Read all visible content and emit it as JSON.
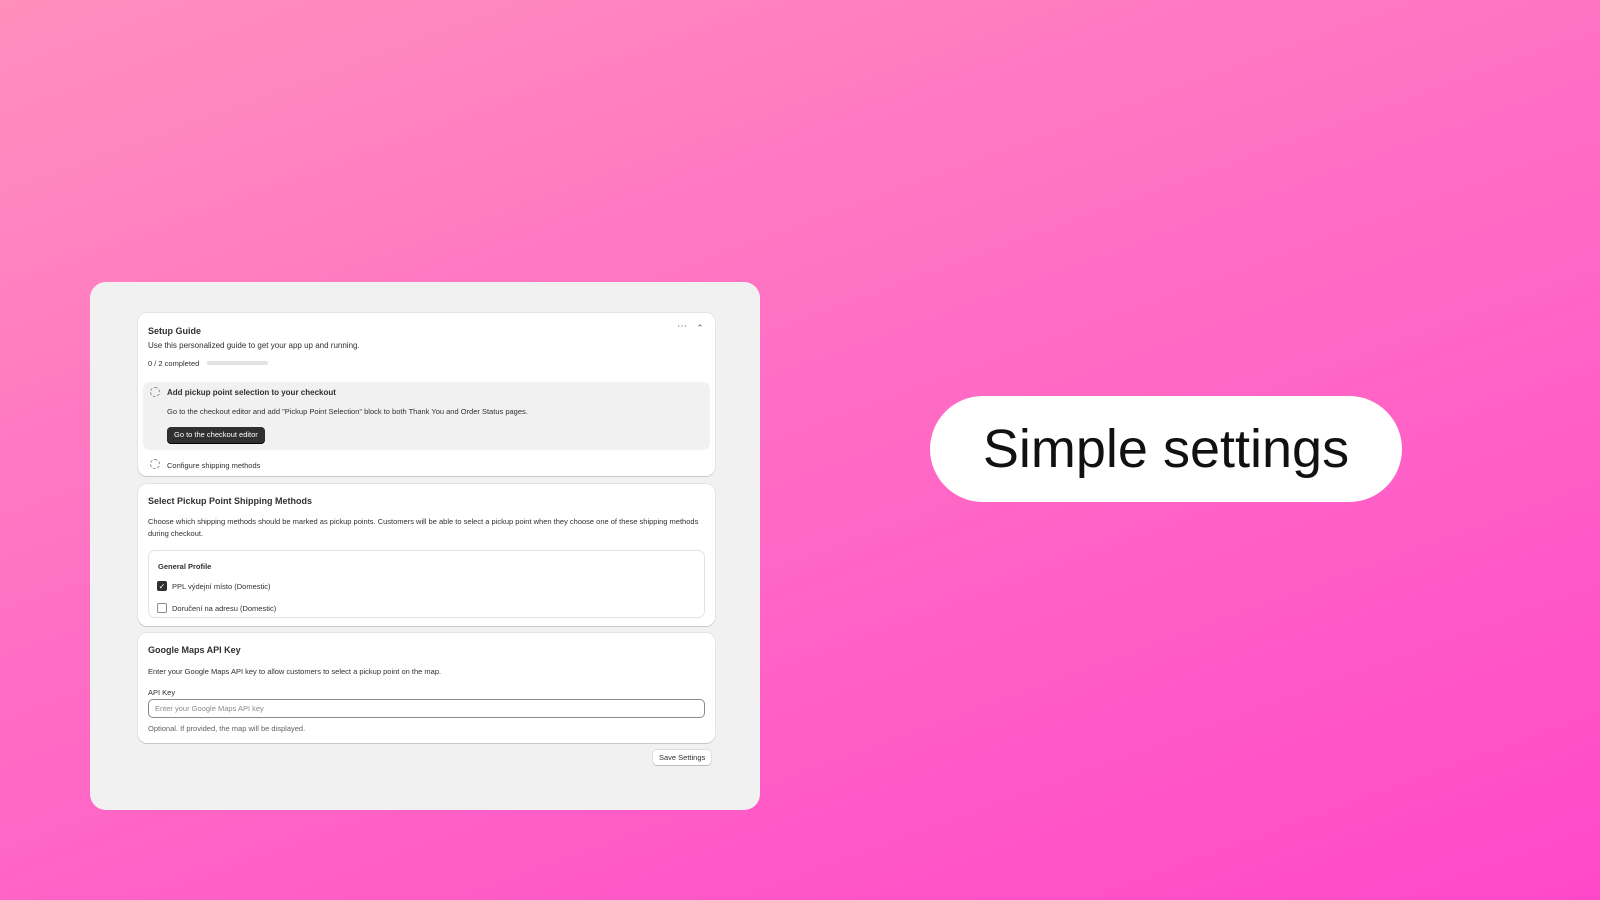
{
  "setup_guide": {
    "title": "Setup Guide",
    "subtitle": "Use this personalized guide to get your app up and running.",
    "progress_text": "0 / 2 completed",
    "progress_fraction": 0,
    "menu_icon": "ellipsis-icon",
    "collapse_icon": "chevron-up-icon",
    "steps": [
      {
        "title": "Add pickup point selection to your checkout",
        "description": "Go to the checkout editor and add \"Pickup Point Selection\" block to both Thank You and Order Status pages.",
        "button_label": "Go to the checkout editor",
        "completed": false
      },
      {
        "title": "Configure shipping methods",
        "completed": false
      }
    ]
  },
  "shipping_methods": {
    "title": "Select Pickup Point Shipping Methods",
    "description": "Choose which shipping methods should be marked as pickup points. Customers will be able to select a pickup point when they choose one of these shipping methods during checkout.",
    "profile_title": "General Profile",
    "options": [
      {
        "label": "PPL výdejní místo (Domestic)",
        "checked": true
      },
      {
        "label": "Doručení na adresu (Domestic)",
        "checked": false
      }
    ]
  },
  "google_maps": {
    "title": "Google Maps API Key",
    "description": "Enter your Google Maps API key to allow customers to select a pickup point on the map.",
    "field_label": "API Key",
    "field_value": "",
    "field_placeholder": "Enter your Google Maps API key",
    "help_text": "Optional. If provided, the map will be displayed."
  },
  "save_button_label": "Save Settings",
  "headline": "Simple settings",
  "colors": {
    "background_start": "#ff8fbd",
    "background_end": "#ff48c9",
    "primary_button": "#303030",
    "panel": "#f1f1f1"
  }
}
